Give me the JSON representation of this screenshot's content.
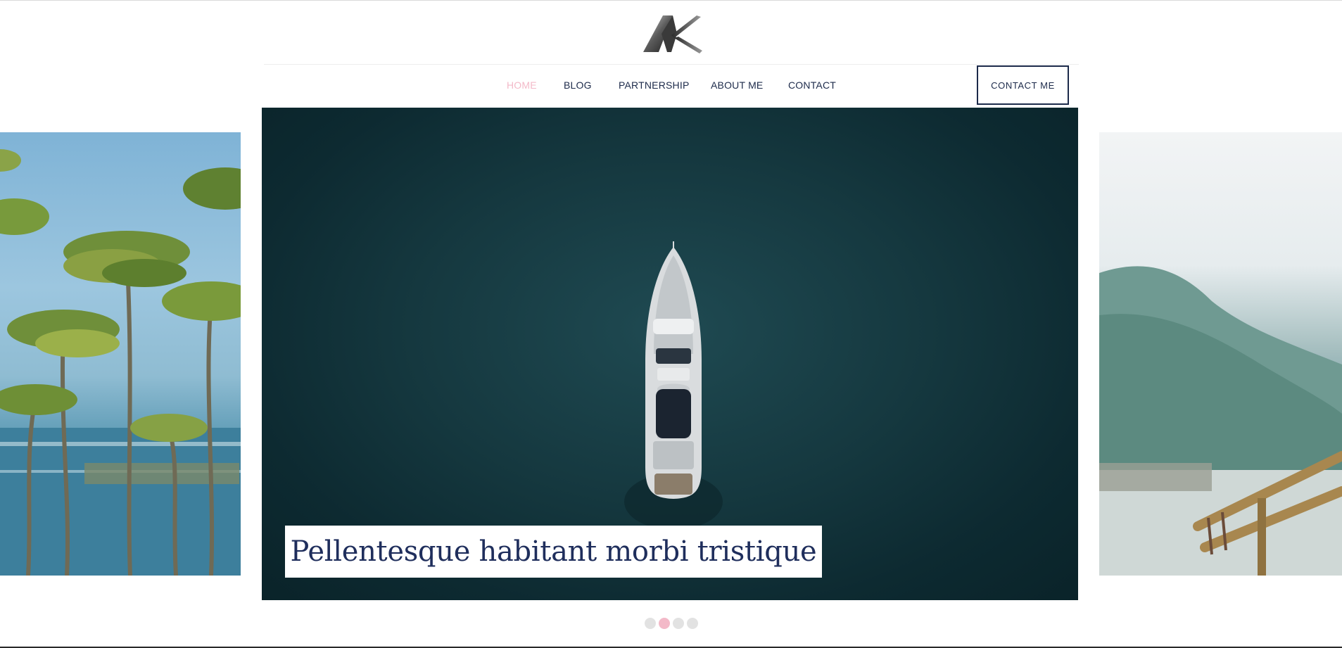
{
  "logo": {
    "text": "AK"
  },
  "nav": {
    "items": [
      {
        "label": "HOME",
        "active": true
      },
      {
        "label": "BLOG",
        "active": false
      },
      {
        "label": "PARTNERSHIP",
        "active": false
      },
      {
        "label": "ABOUT ME",
        "active": false
      },
      {
        "label": "CONTACT",
        "active": false
      }
    ],
    "cta_label": "CONTACT ME"
  },
  "carousel": {
    "caption": "Pellentesque habitant morbi tristique",
    "slide_count": 4,
    "active_index": 1
  },
  "colors": {
    "accent": "#f3b9c8",
    "navy": "#1c2a4a",
    "caption_text": "#1f2e5c",
    "sea": "#15383f"
  }
}
